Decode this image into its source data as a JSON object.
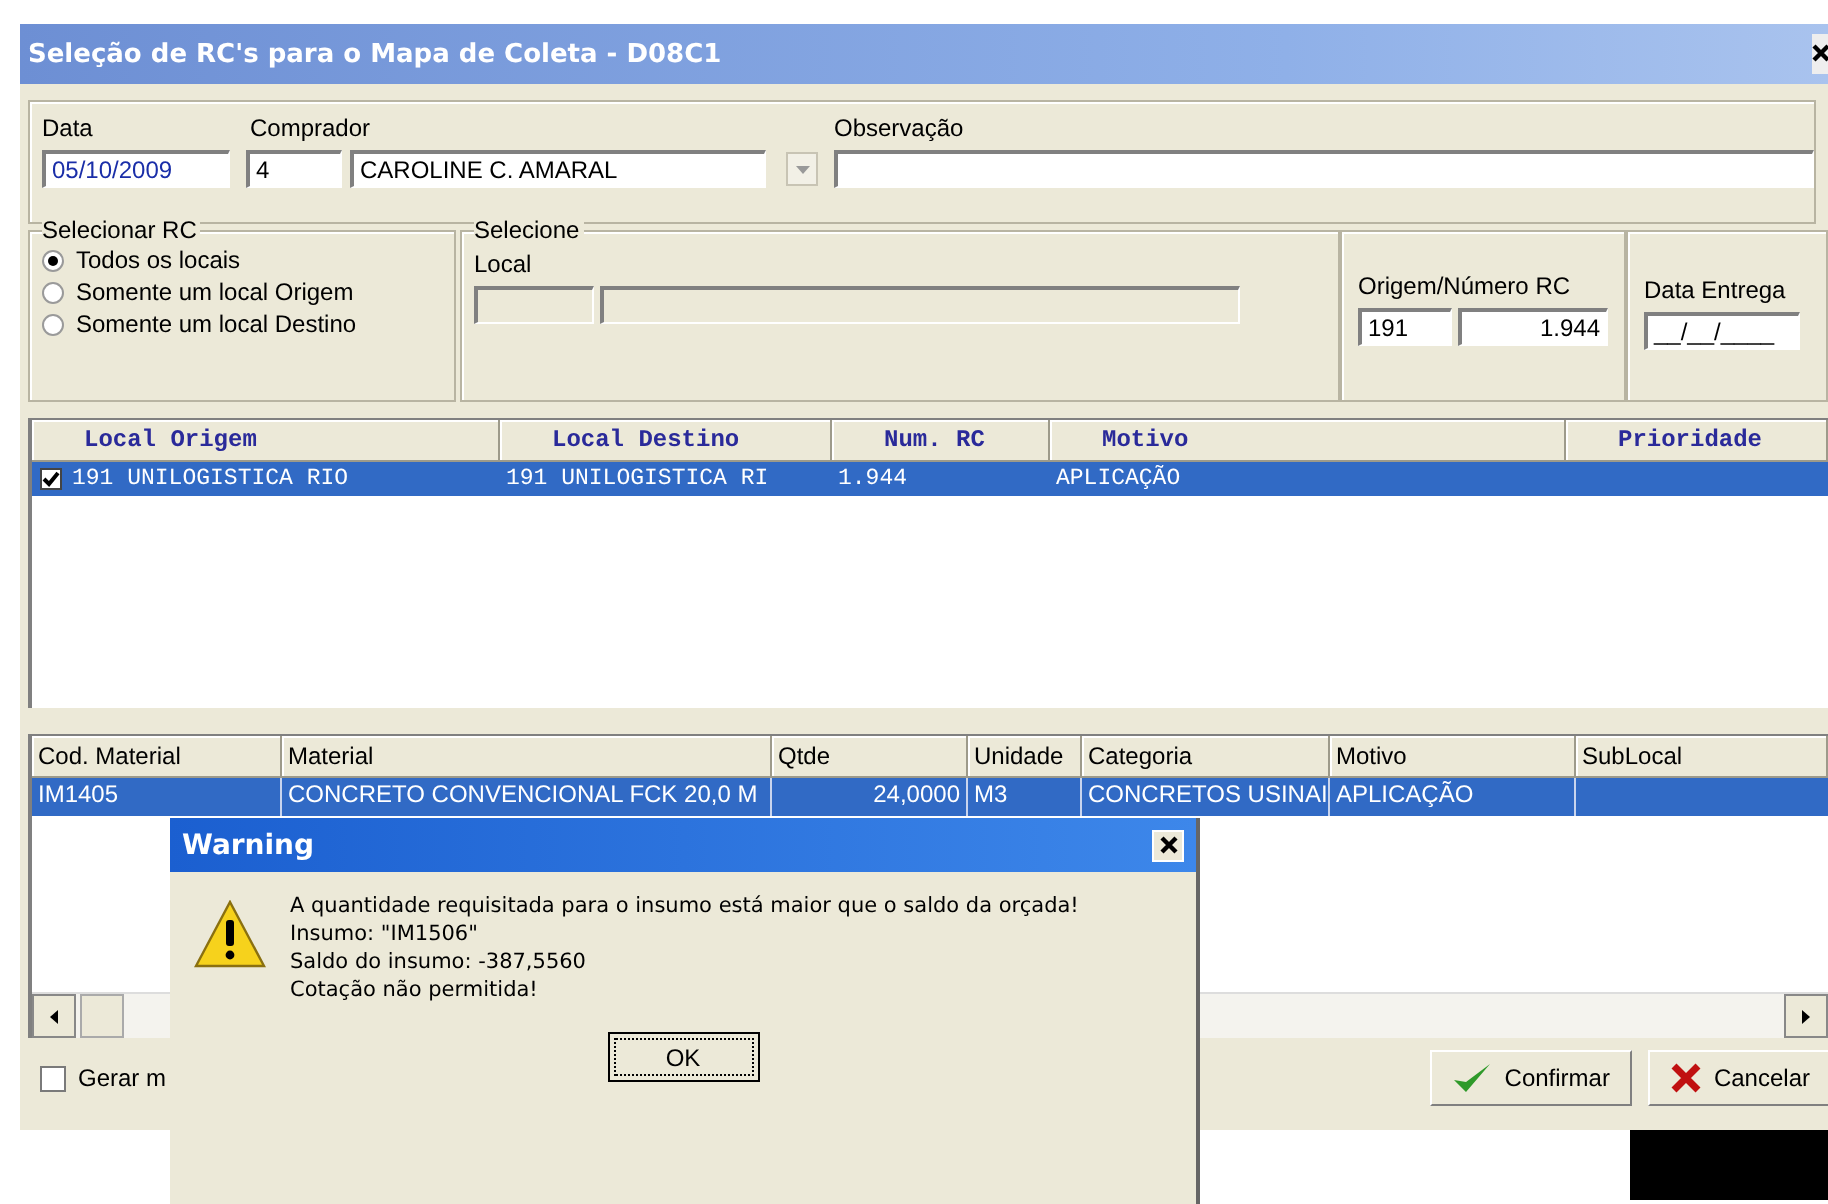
{
  "window": {
    "title": "Seleção de RC's para o Mapa de Coleta - D08C1"
  },
  "header": {
    "data": {
      "label": "Data",
      "value": "05/10/2009"
    },
    "comprador": {
      "label": "Comprador",
      "code": "4",
      "name": "CAROLINE C. AMARAL"
    },
    "observacao": {
      "label": "Observação"
    }
  },
  "selecionar_rc": {
    "title": "Selecionar RC",
    "options": [
      {
        "label": "Todos os locais",
        "selected": true
      },
      {
        "label": "Somente um local Origem",
        "selected": false
      },
      {
        "label": "Somente um local Destino",
        "selected": false
      }
    ]
  },
  "selecione": {
    "title": "Selecione",
    "label": "Local"
  },
  "origem_numero": {
    "label": "Origem/Número RC",
    "origem": "191",
    "numero": "1.944"
  },
  "data_entrega": {
    "label": "Data Entrega",
    "value": "__/__/____"
  },
  "rc_table": {
    "columns": [
      "Local Origem",
      "Local Destino",
      "Num. RC",
      "Motivo",
      "Prioridade"
    ],
    "rows": [
      {
        "checked": true,
        "selected": true,
        "cells": [
          "191 UNILOGISTICA RIO",
          "191 UNILOGISTICA RI",
          "1.944",
          "APLICAÇÃO"
        ]
      }
    ]
  },
  "material_table": {
    "columns": [
      "Cod. Material",
      "Material",
      "Qtde",
      "Unidade",
      "Categoria",
      "Motivo",
      "SubLocal"
    ],
    "rows": [
      {
        "selected": true,
        "cells": [
          "IM1405",
          "CONCRETO CONVENCIONAL FCK 20,0 M",
          "24,0000",
          "M3",
          "CONCRETOS USINAI",
          "APLICAÇÃO"
        ]
      }
    ]
  },
  "gerar_checkbox": {
    "label": "Gerar m",
    "checked": false
  },
  "buttons": [
    {
      "kind": "confirm",
      "label": "Confirmar"
    },
    {
      "kind": "cancel",
      "label": "Cancelar"
    }
  ],
  "warning": {
    "title": "Warning",
    "lines": [
      "A quantidade requisitada para o insumo está maior que o saldo da orçada!",
      "Insumo: \"IM1506\"",
      "Saldo do insumo: -387,5560",
      "Cotação não permitida!"
    ],
    "button": "OK"
  }
}
